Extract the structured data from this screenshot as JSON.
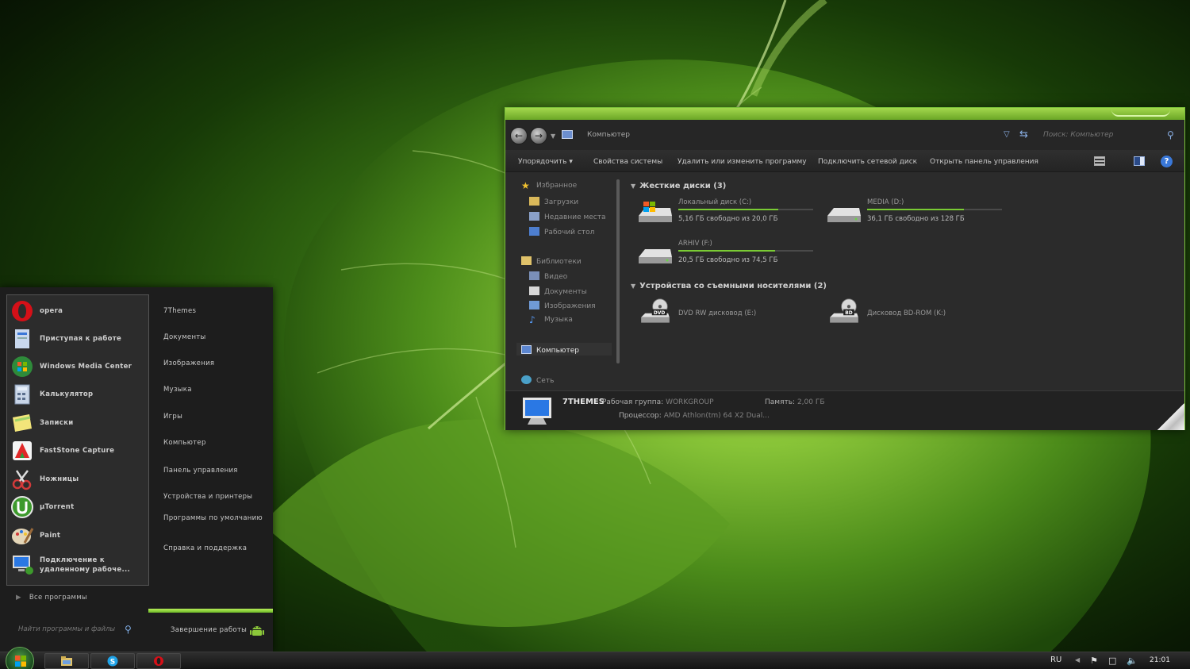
{
  "explorer": {
    "address": "Компьютер",
    "search_placeholder": "Поиск: Компьютер",
    "toolbar": {
      "organize": "Упорядочить",
      "system_properties": "Свойства системы",
      "uninstall": "Удалить или изменить программу",
      "map_drive": "Подключить сетевой диск",
      "control_panel": "Открыть панель управления"
    },
    "nav": {
      "favorites": "Избранное",
      "downloads": "Загрузки",
      "recent": "Недавние места",
      "desktop": "Рабочий стол",
      "libraries": "Библиотеки",
      "video": "Видео",
      "documents": "Документы",
      "pictures": "Изображения",
      "music": "Музыка",
      "computer": "Компьютер",
      "network": "Сеть"
    },
    "hard_drives_header": "Жесткие диски (3)",
    "removable_header": "Устройства со съемными носителями (2)",
    "drives": [
      {
        "name": "Локальный диск (C:)",
        "free": "5,16 ГБ свободно из 20,0 ГБ",
        "used_fraction": 0.74
      },
      {
        "name": "MEDIA (D:)",
        "free": "36,1 ГБ свободно из 128 ГБ",
        "used_fraction": 0.72
      },
      {
        "name": "ARHIV (F:)",
        "free": "20,5 ГБ свободно из 74,5 ГБ",
        "used_fraction": 0.72
      }
    ],
    "removable": [
      {
        "name": "DVD RW дисковод (E:)",
        "badge": "DVD"
      },
      {
        "name": "Дисковод BD-ROM (K:)",
        "badge": "BD"
      }
    ],
    "details": {
      "computer_name": "7THEMES",
      "workgroup_label": "Рабочая группа:",
      "workgroup": "WORKGROUP",
      "memory_label": "Память:",
      "memory": "2,00 ГБ",
      "cpu_label": "Процессор:",
      "cpu": "AMD Athlon(tm) 64 X2 Dual..."
    }
  },
  "startmenu": {
    "pinned": [
      {
        "label": "opera",
        "icon": "opera-icon"
      },
      {
        "label": "Приступая к работе",
        "icon": "getting-started-icon"
      },
      {
        "label": "Windows Media Center",
        "icon": "media-center-icon"
      },
      {
        "label": "Калькулятор",
        "icon": "calculator-icon"
      },
      {
        "label": "Записки",
        "icon": "sticky-notes-icon"
      },
      {
        "label": "FastStone Capture",
        "icon": "faststone-icon"
      },
      {
        "label": "Ножницы",
        "icon": "scissors-icon"
      },
      {
        "label": "µTorrent",
        "icon": "utorrent-icon"
      },
      {
        "label": "Paint",
        "icon": "paint-icon"
      },
      {
        "label": "Подключение к удаленному рабоче...",
        "icon": "remote-desktop-icon"
      }
    ],
    "all_programs": "Все программы",
    "search_placeholder": "Найти программы и файлы",
    "right": [
      "7Themes",
      "Документы",
      "Изображения",
      "Музыка",
      "Игры",
      "Компьютер",
      "Панель управления",
      "Устройства и принтеры",
      "Программы по умолчанию",
      "Справка и поддержка"
    ],
    "shutdown": "Завершение работы"
  },
  "taskbar": {
    "language": "RU",
    "clock": "21:01",
    "apps": [
      "explorer-icon",
      "skype-icon",
      "opera-icon"
    ]
  },
  "colors": {
    "accent_green": "#7acb34",
    "window_bg": "#2b2b2b"
  }
}
